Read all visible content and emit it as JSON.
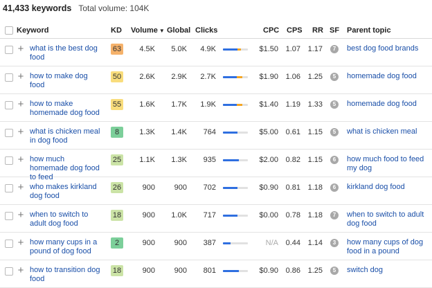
{
  "summary": {
    "count": "41,433 keywords",
    "volume": "Total volume: 104K"
  },
  "headers": {
    "keyword": "Keyword",
    "kd": "KD",
    "volume": "Volume",
    "global": "Global",
    "clicks": "Clicks",
    "cpc": "CPC",
    "cps": "CPS",
    "rr": "RR",
    "sf": "SF",
    "parent": "Parent topic"
  },
  "colors": {
    "link": "#1a4fa8",
    "kd_orange": "#f5b26b",
    "kd_yellow": "#f9dd7c",
    "kd_lightgreen": "#cbe3a6",
    "kd_green": "#7ccf9a",
    "bar_blue": "#2f6fe0",
    "bar_orange": "#f5a623"
  },
  "rows": [
    {
      "keyword": "what is the best dog food",
      "kd": "63",
      "kd_level": "orange",
      "volume": "4.5K",
      "global": "5.0K",
      "clicks": "4.9K",
      "clicks_share": [
        0.58,
        0.14
      ],
      "cpc": "$1.50",
      "cps": "1.07",
      "rr": "1.17",
      "sf": "7",
      "parent": "best dog food brands"
    },
    {
      "keyword": "how to make dog food",
      "kd": "50",
      "kd_level": "yellow",
      "volume": "2.6K",
      "global": "2.9K",
      "clicks": "2.7K",
      "clicks_share": [
        0.55,
        0.22
      ],
      "cpc": "$1.90",
      "cps": "1.06",
      "rr": "1.25",
      "sf": "5",
      "parent": "homemade dog food"
    },
    {
      "keyword": "how to make homemade dog food",
      "kd": "55",
      "kd_level": "yellow",
      "volume": "1.6K",
      "global": "1.7K",
      "clicks": "1.9K",
      "clicks_share": [
        0.55,
        0.22
      ],
      "cpc": "$1.40",
      "cps": "1.19",
      "rr": "1.33",
      "sf": "5",
      "parent": "homemade dog food"
    },
    {
      "keyword": "what is chicken meal in dog food",
      "kd": "8",
      "kd_level": "green",
      "volume": "1.3K",
      "global": "1.4K",
      "clicks": "764",
      "clicks_share": [
        0.58,
        0.0
      ],
      "cpc": "$5.00",
      "cps": "0.61",
      "rr": "1.15",
      "sf": "5",
      "parent": "what is chicken meal"
    },
    {
      "keyword": "how much homemade dog food to feed",
      "kd": "25",
      "kd_level": "lightgreen",
      "volume": "1.1K",
      "global": "1.3K",
      "clicks": "935",
      "clicks_share": [
        0.64,
        0.0
      ],
      "cpc": "$2.00",
      "cps": "0.82",
      "rr": "1.15",
      "sf": "6",
      "parent": "how much food to feed my dog"
    },
    {
      "keyword": "who makes kirkland dog food",
      "kd": "26",
      "kd_level": "lightgreen",
      "volume": "900",
      "global": "900",
      "clicks": "702",
      "clicks_share": [
        0.58,
        0.0
      ],
      "cpc": "$0.90",
      "cps": "0.81",
      "rr": "1.18",
      "sf": "6",
      "parent": "kirkland dog food"
    },
    {
      "keyword": "when to switch to adult dog food",
      "kd": "18",
      "kd_level": "lightgreen",
      "volume": "900",
      "global": "1.0K",
      "clicks": "717",
      "clicks_share": [
        0.58,
        0.0
      ],
      "cpc": "$0.00",
      "cps": "0.78",
      "rr": "1.18",
      "sf": "7",
      "parent": "when to switch to adult dog food"
    },
    {
      "keyword": "how many cups in a pound of dog food",
      "kd": "2",
      "kd_level": "green",
      "volume": "900",
      "global": "900",
      "clicks": "387",
      "clicks_share": [
        0.3,
        0.0
      ],
      "cpc": "N/A",
      "cps": "0.44",
      "rr": "1.14",
      "sf": "3",
      "parent": "how many cups of dog food in a pound"
    },
    {
      "keyword": "how to transition dog food",
      "kd": "18",
      "kd_level": "lightgreen",
      "volume": "900",
      "global": "900",
      "clicks": "801",
      "clicks_share": [
        0.64,
        0.0
      ],
      "cpc": "$0.90",
      "cps": "0.86",
      "rr": "1.25",
      "sf": "5",
      "parent": "switch dog"
    }
  ]
}
